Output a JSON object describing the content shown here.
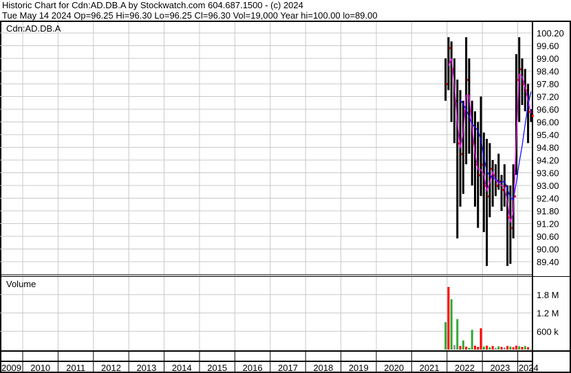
{
  "header": {
    "title": "Historic Chart for Cdn:AD.DB.A by Stockwatch.com 604.687.1500 - (c) 2024",
    "quote_line": "Tue May  14 2024   Op=96.25  Hi=96.30   Lo=96.25   Cl=96.30   Vol=19,000   Year hi=100.00   lo=89.00"
  },
  "chart_data": {
    "type": "ohlc",
    "symbol_label": "Cdn:AD.DB.A",
    "volume_label": "Volume",
    "colors": {
      "bar": "#000000",
      "close_tick": "#ff0000",
      "ma_short": "#ff00ff",
      "ma_long": "#0000ff",
      "vol_up": "#33aa33",
      "vol_down": "#ff0000",
      "vol_flat": "#999999",
      "grid": "#c8c8c8"
    },
    "price_ticks": [
      "100.20",
      "99.60",
      "99.00",
      "98.40",
      "97.80",
      "97.20",
      "96.60",
      "96.00",
      "95.40",
      "94.80",
      "94.20",
      "93.60",
      "93.00",
      "92.40",
      "91.80",
      "91.20",
      "90.60",
      "90.00",
      "89.40"
    ],
    "volume_ticks": [
      {
        "label": "1.8 M",
        "value": 1800000
      },
      {
        "label": "1.2 M",
        "value": 1200000
      },
      {
        "label": "600 k",
        "value": 600000
      }
    ],
    "years": [
      "2009",
      "2010",
      "2011",
      "2012",
      "2013",
      "2014",
      "2015",
      "2016",
      "2017",
      "2018",
      "2019",
      "2020",
      "2021",
      "2022",
      "2023",
      "2024"
    ],
    "ylim": [
      89.0,
      100.5
    ],
    "ma_short_period": 2,
    "ma_long_period": 6,
    "bars": [
      {
        "t": "2021-12",
        "h": 99.0,
        "l": 97.0,
        "c": 97.8,
        "v": 900000,
        "d": "up"
      },
      {
        "t": "2022-01",
        "h": 100.0,
        "l": 97.5,
        "c": 99.5,
        "v": 2050000,
        "d": "down"
      },
      {
        "t": "2022-02",
        "h": 99.8,
        "l": 96.0,
        "c": 98.5,
        "v": 1650000,
        "d": "up"
      },
      {
        "t": "2022-03",
        "h": 99.0,
        "l": 95.0,
        "c": 97.0,
        "v": 150000,
        "d": "flat"
      },
      {
        "t": "2022-04",
        "h": 98.0,
        "l": 90.5,
        "c": 95.0,
        "v": 1000000,
        "d": "up"
      },
      {
        "t": "2022-05",
        "h": 97.5,
        "l": 92.0,
        "c": 94.5,
        "v": 120000,
        "d": "down"
      },
      {
        "t": "2022-06",
        "h": 97.0,
        "l": 92.6,
        "c": 96.5,
        "v": 300000,
        "d": "up"
      },
      {
        "t": "2022-07",
        "h": 100.0,
        "l": 94.0,
        "c": 98.0,
        "v": 100000,
        "d": "down"
      },
      {
        "t": "2022-08",
        "h": 99.0,
        "l": 94.5,
        "c": 96.5,
        "v": 60000,
        "d": "up"
      },
      {
        "t": "2022-09",
        "h": 97.0,
        "l": 93.0,
        "c": 95.0,
        "v": 650000,
        "d": "up"
      },
      {
        "t": "2022-10",
        "h": 96.5,
        "l": 92.0,
        "c": 94.0,
        "v": 130000,
        "d": "down"
      },
      {
        "t": "2022-11",
        "h": 96.0,
        "l": 91.0,
        "c": 93.5,
        "v": 90000,
        "d": "down"
      },
      {
        "t": "2022-12",
        "h": 97.2,
        "l": 92.5,
        "c": 94.0,
        "v": 700000,
        "d": "down"
      },
      {
        "t": "2023-01",
        "h": 95.5,
        "l": 90.8,
        "c": 93.0,
        "v": 100000,
        "d": "up"
      },
      {
        "t": "2023-02",
        "h": 95.2,
        "l": 89.2,
        "c": 92.5,
        "v": 130000,
        "d": "down"
      },
      {
        "t": "2023-03",
        "h": 95.0,
        "l": 91.5,
        "c": 93.8,
        "v": 80000,
        "d": "up"
      },
      {
        "t": "2023-04",
        "h": 94.2,
        "l": 92.0,
        "c": 93.5,
        "v": 120000,
        "d": "down"
      },
      {
        "t": "2023-05",
        "h": 94.0,
        "l": 92.5,
        "c": 93.0,
        "v": 60000,
        "d": "flat"
      },
      {
        "t": "2023-06",
        "h": 94.5,
        "l": 92.8,
        "c": 93.2,
        "v": 110000,
        "d": "up"
      },
      {
        "t": "2023-07",
        "h": 93.5,
        "l": 91.8,
        "c": 92.8,
        "v": 90000,
        "d": "down"
      },
      {
        "t": "2023-08",
        "h": 94.0,
        "l": 92.0,
        "c": 93.0,
        "v": 70000,
        "d": "flat"
      },
      {
        "t": "2023-09",
        "h": 93.0,
        "l": 89.2,
        "c": 91.5,
        "v": 120000,
        "d": "down"
      },
      {
        "t": "2023-10",
        "h": 93.0,
        "l": 89.3,
        "c": 91.0,
        "v": 100000,
        "d": "up"
      },
      {
        "t": "2023-11",
        "h": 94.0,
        "l": 90.5,
        "c": 92.5,
        "v": 80000,
        "d": "down"
      },
      {
        "t": "2023-12",
        "h": 99.2,
        "l": 93.5,
        "c": 98.0,
        "v": 130000,
        "d": "down"
      },
      {
        "t": "2024-01",
        "h": 100.0,
        "l": 96.0,
        "c": 98.5,
        "v": 110000,
        "d": "up"
      },
      {
        "t": "2024-02",
        "h": 99.0,
        "l": 96.8,
        "c": 97.8,
        "v": 90000,
        "d": "down"
      },
      {
        "t": "2024-03",
        "h": 98.5,
        "l": 96.5,
        "c": 97.5,
        "v": 120000,
        "d": "up"
      },
      {
        "t": "2024-04",
        "h": 97.8,
        "l": 95.0,
        "c": 96.5,
        "v": 80000,
        "d": "down"
      },
      {
        "t": "2024-05",
        "h": 96.6,
        "l": 96.0,
        "c": 96.3,
        "v": 19000,
        "d": "up"
      }
    ]
  }
}
